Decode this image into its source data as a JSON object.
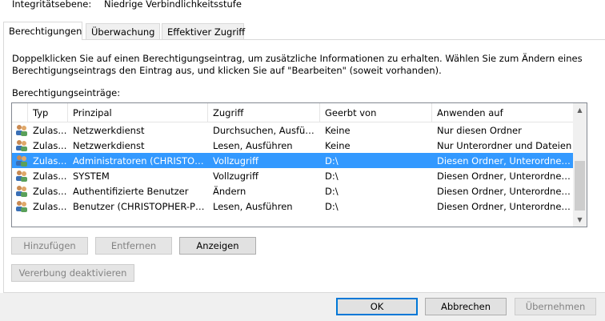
{
  "integrity": {
    "label": "Integritätsebene:",
    "value": "Niedrige Verbindlichkeitsstufe"
  },
  "tabs": [
    {
      "label": "Berechtigungen",
      "active": true
    },
    {
      "label": "Überwachung",
      "active": false
    },
    {
      "label": "Effektiver Zugriff",
      "active": false
    }
  ],
  "info_text": {
    "line1": "Doppelklicken Sie auf einen Berechtigungseintrag, um zusätzliche Informationen zu erhalten. Wählen Sie zum Ändern eines",
    "line2": "Berechtigungseintrags den Eintrag aus, und klicken Sie auf \"Bearbeiten\" (soweit vorhanden)."
  },
  "list_label": "Berechtigungseinträge:",
  "columns": [
    "Typ",
    "Prinzipal",
    "Zugriff",
    "Geerbt von",
    "Anwenden auf"
  ],
  "rows": [
    {
      "typ": "Zulas...",
      "prinzipal": "Netzwerkdienst",
      "zugriff": "Durchsuchen, Ausführ...",
      "geerbt": "Keine",
      "anwenden": "Nur diesen Ordner",
      "selected": false
    },
    {
      "typ": "Zulas...",
      "prinzipal": "Netzwerkdienst",
      "zugriff": "Lesen, Ausführen",
      "geerbt": "Keine",
      "anwenden": "Nur Unterordner und Dateien",
      "selected": false
    },
    {
      "typ": "Zulas...",
      "prinzipal": "Administratoren (CHRISTOP...",
      "zugriff": "Vollzugriff",
      "geerbt": "D:\\",
      "anwenden": "Diesen Ordner, Unterordner u...",
      "selected": true
    },
    {
      "typ": "Zulas...",
      "prinzipal": "SYSTEM",
      "zugriff": "Vollzugriff",
      "geerbt": "D:\\",
      "anwenden": "Diesen Ordner, Unterordner u...",
      "selected": false
    },
    {
      "typ": "Zulas...",
      "prinzipal": "Authentifizierte Benutzer",
      "zugriff": "Ändern",
      "geerbt": "D:\\",
      "anwenden": "Diesen Ordner, Unterordner u...",
      "selected": false
    },
    {
      "typ": "Zulas...",
      "prinzipal": "Benutzer (CHRISTOPHER-PC...",
      "zugriff": "Lesen, Ausführen",
      "geerbt": "D:\\",
      "anwenden": "Diesen Ordner, Unterordner u...",
      "selected": false
    }
  ],
  "buttons": {
    "add": "Hinzufügen",
    "remove": "Entfernen",
    "view": "Anzeigen",
    "disable_inheritance": "Vererbung deaktivieren",
    "ok": "OK",
    "cancel": "Abbrechen",
    "apply": "Übernehmen"
  },
  "icons": {
    "user_group": "user-group-icon",
    "scroll_up": "scroll-up-arrow-icon",
    "scroll_down": "scroll-down-arrow-icon"
  },
  "colors": {
    "selection": "#3399ff",
    "default_button_border": "#0078d7"
  }
}
